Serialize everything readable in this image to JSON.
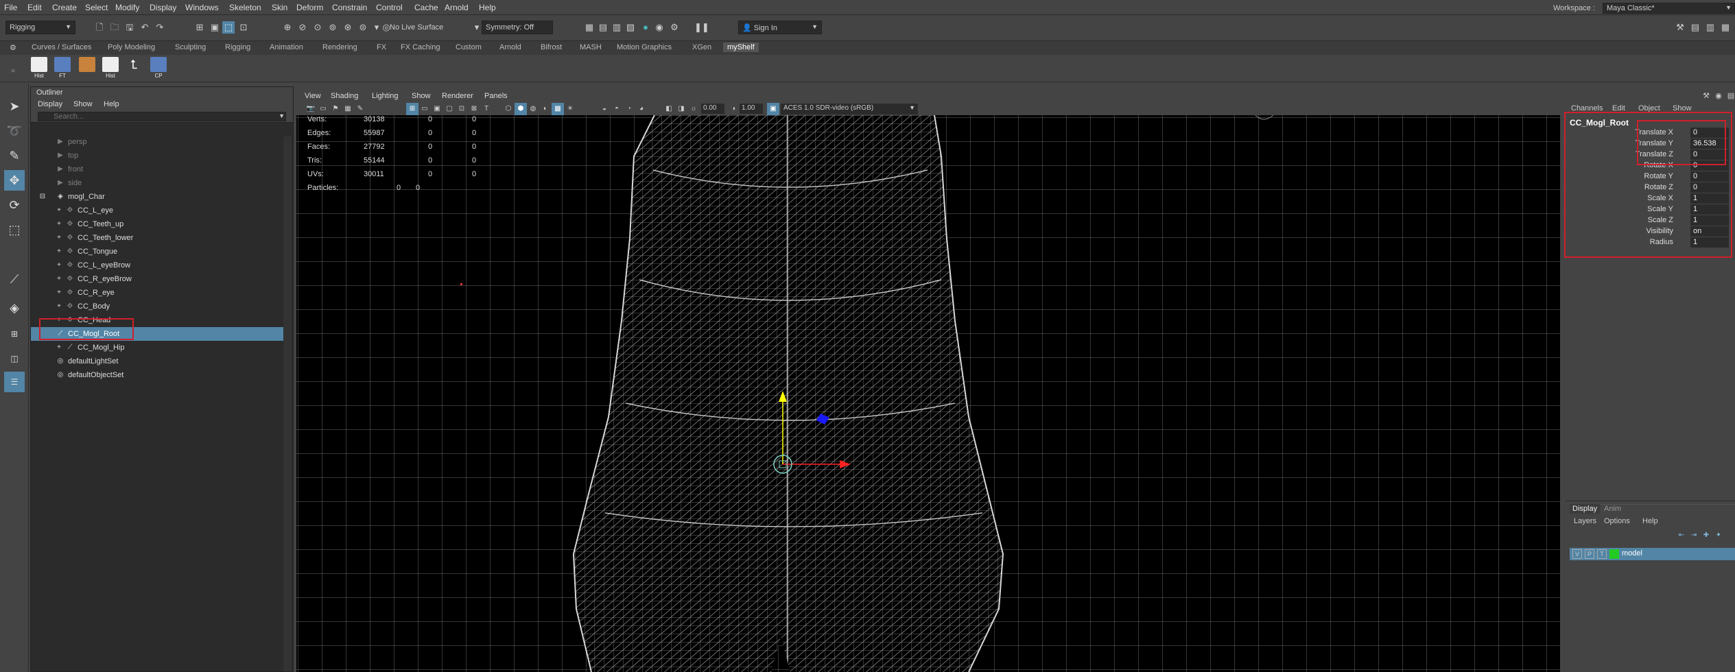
{
  "menubar": {
    "items": [
      "File",
      "Edit",
      "Create",
      "Select",
      "Modify",
      "Display",
      "Windows",
      "Skeleton",
      "Skin",
      "Deform",
      "Constrain",
      "Control",
      "Cache",
      "Arnold",
      "Help"
    ],
    "workspace_label": "Workspace :",
    "workspace_value": "Maya Classic*"
  },
  "statusline": {
    "mode": "Rigging",
    "live_surface": "No Live Surface",
    "symmetry": "Symmetry: Off",
    "sign_in": "Sign In"
  },
  "shelf": {
    "tabs": [
      "Curves / Surfaces",
      "Poly Modeling",
      "Sculpting",
      "Rigging",
      "Animation",
      "Rendering",
      "FX",
      "FX Caching",
      "Custom",
      "Arnold",
      "Bifrost",
      "MASH",
      "Motion Graphics",
      "XGen",
      "myShelf"
    ],
    "active_tab": "myShelf",
    "icons": [
      "Hist",
      "FT",
      "",
      "Hist",
      "",
      "CP"
    ]
  },
  "outliner": {
    "title": "Outliner",
    "menus": [
      "Display",
      "Show",
      "Help"
    ],
    "search_placeholder": "Search...",
    "rows": [
      {
        "label": "persp",
        "type": "camera",
        "dim": true
      },
      {
        "label": "top",
        "type": "camera",
        "dim": true
      },
      {
        "label": "front",
        "type": "camera",
        "dim": true
      },
      {
        "label": "side",
        "type": "camera",
        "dim": true
      },
      {
        "label": "mogl_Char",
        "type": "group",
        "dim": false
      },
      {
        "label": "CC_L_eye",
        "type": "mesh",
        "dim": false
      },
      {
        "label": "CC_Teeth_up",
        "type": "mesh",
        "dim": false
      },
      {
        "label": "CC_Teeth_lower",
        "type": "mesh",
        "dim": false
      },
      {
        "label": "CC_Tongue",
        "type": "mesh",
        "dim": false
      },
      {
        "label": "CC_L_eyeBrow",
        "type": "mesh",
        "dim": false
      },
      {
        "label": "CC_R_eyeBrow",
        "type": "mesh",
        "dim": false
      },
      {
        "label": "CC_R_eye",
        "type": "mesh",
        "dim": false
      },
      {
        "label": "CC_Body",
        "type": "mesh",
        "dim": false
      },
      {
        "label": "CC_Head",
        "type": "mesh",
        "dim": false
      },
      {
        "label": "CC_Mogl_Root",
        "type": "joint",
        "dim": false,
        "selected": true
      },
      {
        "label": "CC_Mogl_Hip",
        "type": "joint",
        "dim": false
      },
      {
        "label": "defaultLightSet",
        "type": "set",
        "dim": false
      },
      {
        "label": "defaultObjectSet",
        "type": "set",
        "dim": false
      }
    ]
  },
  "viewport": {
    "menus": [
      "View",
      "Shading",
      "Lighting",
      "Show",
      "Renderer",
      "Panels"
    ],
    "field_1": "0.00",
    "field_2": "1.00",
    "color_space": "ACES 1.0 SDR-video (sRGB)",
    "hud": [
      {
        "label": "Verts:",
        "v1": "30138",
        "v2": "0",
        "v3": "0"
      },
      {
        "label": "Edges:",
        "v1": "55987",
        "v2": "0",
        "v3": "0"
      },
      {
        "label": "Faces:",
        "v1": "27792",
        "v2": "0",
        "v3": "0"
      },
      {
        "label": "Tris:",
        "v1": "55144",
        "v2": "0",
        "v3": "0"
      },
      {
        "label": "UVs:",
        "v1": "30011",
        "v2": "0",
        "v3": "0"
      },
      {
        "label": "Particles:",
        "v1": "0",
        "v2": "0",
        "v3": ""
      }
    ]
  },
  "channelbox": {
    "menus": [
      "Channels",
      "Edit",
      "Object",
      "Show"
    ],
    "node": "CC_Mogl_Root",
    "attributes": [
      {
        "name": "Translate X",
        "value": "0"
      },
      {
        "name": "Translate Y",
        "value": "36.538"
      },
      {
        "name": "Translate Z",
        "value": "0"
      },
      {
        "name": "Rotate X",
        "value": "0"
      },
      {
        "name": "Rotate Y",
        "value": "0"
      },
      {
        "name": "Rotate Z",
        "value": "0"
      },
      {
        "name": "Scale X",
        "value": "1"
      },
      {
        "name": "Scale Y",
        "value": "1"
      },
      {
        "name": "Scale Z",
        "value": "1"
      },
      {
        "name": "Visibility",
        "value": "on"
      },
      {
        "name": "Radius",
        "value": "1"
      }
    ]
  },
  "layers": {
    "tabs": [
      "Display",
      "Anim"
    ],
    "menus": [
      "Layers",
      "Options",
      "Help"
    ],
    "layer_flags": [
      "V",
      "P",
      "T"
    ],
    "layer_name": "model",
    "layer_color": "#22cc22"
  },
  "colors": {
    "selection": "#5285a6",
    "highlight_box": "#d0202a"
  }
}
